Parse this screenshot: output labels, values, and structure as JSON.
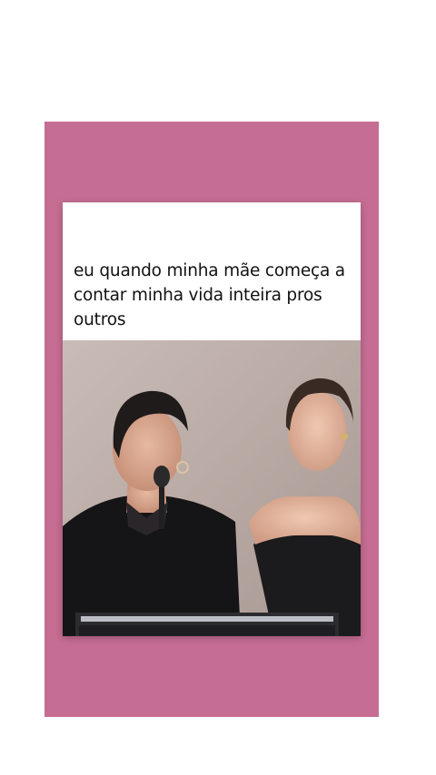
{
  "story": {
    "background_color": "#c66d93",
    "caption": "eu quando minha mãe começa a contar minha vida inteira pros outros"
  },
  "video": {
    "description_icon": "video-still-icon"
  }
}
